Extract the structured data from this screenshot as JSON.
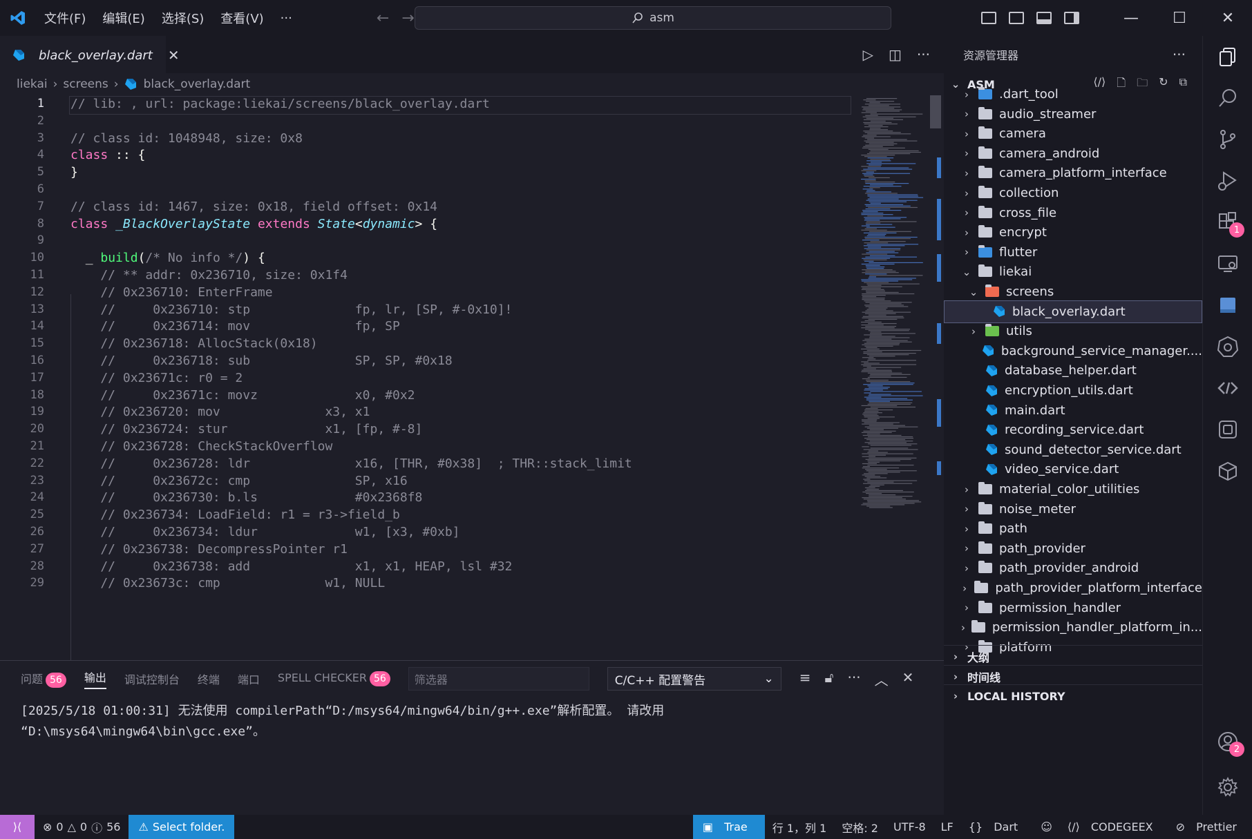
{
  "titlebar": {
    "menu": [
      "文件(F)",
      "编辑(E)",
      "选择(S)",
      "查看(V)",
      "···"
    ],
    "search_text": "asm"
  },
  "tab": {
    "label": "black_overlay.dart"
  },
  "breadcrumb": [
    "liekai",
    "screens",
    "black_overlay.dart"
  ],
  "editor": {
    "lines": [
      {
        "n": "1",
        "text": "// lib: , url: package:liekai/screens/black_overlay.dart",
        "kind": "cm"
      },
      {
        "n": "2",
        "text": "",
        "kind": "cm"
      },
      {
        "n": "3",
        "text": "// class id: 1048948, size: 0x8",
        "kind": "cm"
      },
      {
        "n": "4",
        "text": "class :: {",
        "kind": "class1"
      },
      {
        "n": "5",
        "text": "}",
        "kind": "pn"
      },
      {
        "n": "6",
        "text": "",
        "kind": "cm"
      },
      {
        "n": "7",
        "text": "// class id: 1467, size: 0x18, field offset: 0x14",
        "kind": "cm"
      },
      {
        "n": "8",
        "text": "class _BlackOverlayState extends State<dynamic> {",
        "kind": "class2"
      },
      {
        "n": "9",
        "text": "",
        "kind": "cm"
      },
      {
        "n": "10",
        "text": "  _ build(/* No info */) {",
        "kind": "build"
      },
      {
        "n": "11",
        "text": "    // ** addr: 0x236710, size: 0x1f4",
        "kind": "cm"
      },
      {
        "n": "12",
        "text": "    // 0x236710: EnterFrame",
        "kind": "cm"
      },
      {
        "n": "13",
        "text": "    //     0x236710: stp              fp, lr, [SP, #-0x10]!",
        "kind": "cm"
      },
      {
        "n": "14",
        "text": "    //     0x236714: mov              fp, SP",
        "kind": "cm"
      },
      {
        "n": "15",
        "text": "    // 0x236718: AllocStack(0x18)",
        "kind": "cm"
      },
      {
        "n": "16",
        "text": "    //     0x236718: sub              SP, SP, #0x18",
        "kind": "cm"
      },
      {
        "n": "17",
        "text": "    // 0x23671c: r0 = 2",
        "kind": "cm"
      },
      {
        "n": "18",
        "text": "    //     0x23671c: movz             x0, #0x2",
        "kind": "cm"
      },
      {
        "n": "19",
        "text": "    // 0x236720: mov              x3, x1",
        "kind": "cm"
      },
      {
        "n": "20",
        "text": "    // 0x236724: stur             x1, [fp, #-8]",
        "kind": "cm"
      },
      {
        "n": "21",
        "text": "    // 0x236728: CheckStackOverflow",
        "kind": "cm"
      },
      {
        "n": "22",
        "text": "    //     0x236728: ldr              x16, [THR, #0x38]  ; THR::stack_limit",
        "kind": "cm"
      },
      {
        "n": "23",
        "text": "    //     0x23672c: cmp              SP, x16",
        "kind": "cm"
      },
      {
        "n": "24",
        "text": "    //     0x236730: b.ls             #0x2368f8",
        "kind": "cm"
      },
      {
        "n": "25",
        "text": "    // 0x236734: LoadField: r1 = r3->field_b",
        "kind": "cm"
      },
      {
        "n": "26",
        "text": "    //     0x236734: ldur             w1, [x3, #0xb]",
        "kind": "cm"
      },
      {
        "n": "27",
        "text": "    // 0x236738: DecompressPointer r1",
        "kind": "cm"
      },
      {
        "n": "28",
        "text": "    //     0x236738: add              x1, x1, HEAP, lsl #32",
        "kind": "cm"
      },
      {
        "n": "29",
        "text": "    // 0x23673c: cmp              w1, NULL",
        "kind": "cm"
      }
    ]
  },
  "panel": {
    "tabs": [
      {
        "label": "问题",
        "badge": "56"
      },
      {
        "label": "输出",
        "badge": ""
      },
      {
        "label": "调试控制台",
        "badge": ""
      },
      {
        "label": "终端",
        "badge": ""
      },
      {
        "label": "端口",
        "badge": ""
      },
      {
        "label": "SPELL CHECKER",
        "badge": "56"
      }
    ],
    "filter_placeholder": "筛选器",
    "output_channel": "C/C++ 配置警告",
    "output_lines": [
      "[2025/5/18 01:00:31] 无法使用 compilerPath“D:/msys64/mingw64/bin/g++.exe”解析配置。 请改用",
      "“D:\\msys64\\mingw64\\bin\\gcc.exe”。"
    ]
  },
  "explorer": {
    "title": "资源管理器",
    "root": "ASM",
    "items": [
      {
        "label": ".dart_tool",
        "depth": 0,
        "type": "folder-special",
        "expanded": false
      },
      {
        "label": "audio_streamer",
        "depth": 0,
        "type": "folder",
        "expanded": false
      },
      {
        "label": "camera",
        "depth": 0,
        "type": "folder",
        "expanded": false
      },
      {
        "label": "camera_android",
        "depth": 0,
        "type": "folder",
        "expanded": false
      },
      {
        "label": "camera_platform_interface",
        "depth": 0,
        "type": "folder",
        "expanded": false
      },
      {
        "label": "collection",
        "depth": 0,
        "type": "folder",
        "expanded": false
      },
      {
        "label": "cross_file",
        "depth": 0,
        "type": "folder",
        "expanded": false
      },
      {
        "label": "encrypt",
        "depth": 0,
        "type": "folder",
        "expanded": false
      },
      {
        "label": "flutter",
        "depth": 0,
        "type": "folder-flutter",
        "expanded": false
      },
      {
        "label": "liekai",
        "depth": 0,
        "type": "folder-open",
        "expanded": true
      },
      {
        "label": "screens",
        "depth": 1,
        "type": "folder-screens",
        "expanded": true
      },
      {
        "label": "black_overlay.dart",
        "depth": 2,
        "type": "dart",
        "selected": true
      },
      {
        "label": "utils",
        "depth": 1,
        "type": "folder-utils",
        "expanded": false
      },
      {
        "label": "background_service_manager....",
        "depth": 1,
        "type": "dart"
      },
      {
        "label": "database_helper.dart",
        "depth": 1,
        "type": "dart"
      },
      {
        "label": "encryption_utils.dart",
        "depth": 1,
        "type": "dart"
      },
      {
        "label": "main.dart",
        "depth": 1,
        "type": "dart"
      },
      {
        "label": "recording_service.dart",
        "depth": 1,
        "type": "dart"
      },
      {
        "label": "sound_detector_service.dart",
        "depth": 1,
        "type": "dart"
      },
      {
        "label": "video_service.dart",
        "depth": 1,
        "type": "dart"
      },
      {
        "label": "material_color_utilities",
        "depth": 0,
        "type": "folder",
        "expanded": false
      },
      {
        "label": "noise_meter",
        "depth": 0,
        "type": "folder",
        "expanded": false
      },
      {
        "label": "path",
        "depth": 0,
        "type": "folder",
        "expanded": false
      },
      {
        "label": "path_provider",
        "depth": 0,
        "type": "folder",
        "expanded": false
      },
      {
        "label": "path_provider_android",
        "depth": 0,
        "type": "folder",
        "expanded": false
      },
      {
        "label": "path_provider_platform_interface",
        "depth": 0,
        "type": "folder",
        "expanded": false
      },
      {
        "label": "permission_handler",
        "depth": 0,
        "type": "folder",
        "expanded": false
      },
      {
        "label": "permission_handler_platform_in...",
        "depth": 0,
        "type": "folder",
        "expanded": false
      },
      {
        "label": "platform",
        "depth": 0,
        "type": "folder",
        "expanded": false
      }
    ],
    "sections": [
      "大纲",
      "时间线",
      "LOCAL HISTORY"
    ]
  },
  "activity": {
    "extensions_badge": "1",
    "account_badge": "2"
  },
  "statusbar": {
    "errors": "0",
    "warnings": "0",
    "infos": "56",
    "select_folder": "Select folder.",
    "trae": "Trae",
    "position": "行 1，列 1",
    "spaces": "空格: 2",
    "encoding": "UTF-8",
    "eol": "LF",
    "language": "Dart",
    "codegeex": "CODEGEEX",
    "prettier": "Prettier"
  },
  "colors": {
    "accent_blue": "#1f8ad2",
    "badge_pink": "#ff5fa2",
    "remote_purple": "#b86bd6",
    "dart_blue": "#1fa3f0"
  }
}
